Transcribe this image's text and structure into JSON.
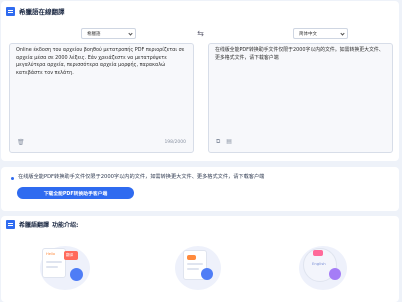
{
  "header": {
    "title": "希臘語在線翻譯"
  },
  "languages": {
    "source": "希臘語",
    "target": "简体中文",
    "swap_icon": "swap-arrows-icon"
  },
  "source_pane": {
    "text": "Online έκδοση του αρχείου βοηθού μετατροπής PDF περιορίζεται σε αρχεία μέσα σε 2000 λέξεις. Εάν χρειάζεστε να μετατρέψετε μεγαλύτερα αρχεία, περισσότερα αρχεία μορφής, παρακαλώ κατεβάστε τον πελάτη.",
    "counter": "198/2000",
    "clear_icon": "trash-icon"
  },
  "target_pane": {
    "text": "在线版全能PDF转换助手文件仅限于2000字以内的文件。如需转换更大文件、更多格式文件，请下载客户端",
    "icons": [
      "copy-icon",
      "document-icon"
    ]
  },
  "notice": {
    "text": "在线版全能PDF转换助手文件仅限于2000字以内的文件，如需转换更大文件、更多格式文件，请下载客户端",
    "button": "下载全能PDF转换助手客户端"
  },
  "features": {
    "title": "希臘語翻譯",
    "subtitle": "功能介绍:",
    "art_labels": [
      "Hello",
      "翻译",
      "English"
    ]
  },
  "colors": {
    "accent": "#2f6bf0",
    "background": "#eef2f9"
  }
}
